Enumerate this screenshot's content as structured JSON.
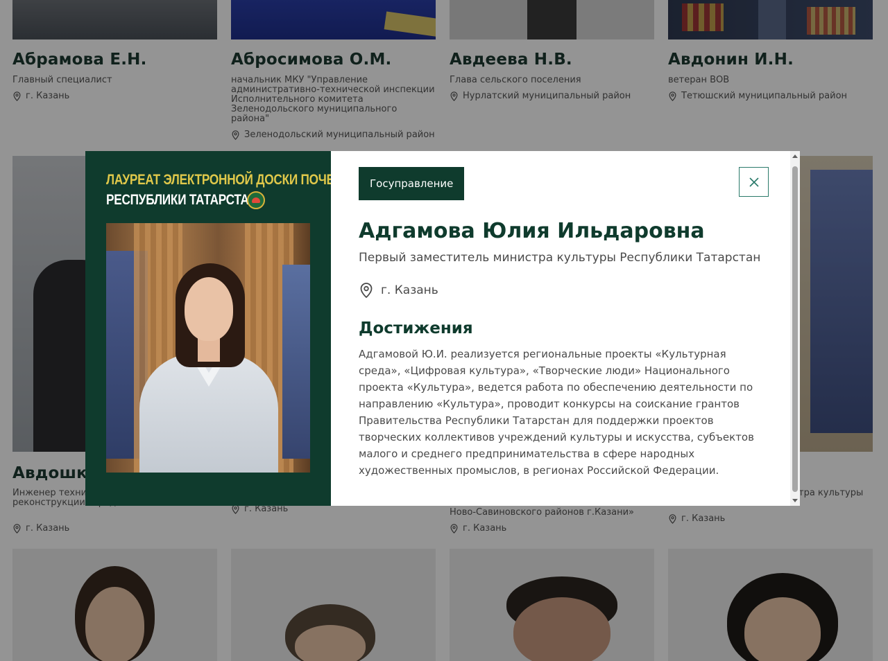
{
  "grid": {
    "row1": [
      {
        "name": "Абрамова Е.Н.",
        "position": "Главный специалист",
        "location": "г. Казань"
      },
      {
        "name": "Абросимова О.М.",
        "position": "начальник МКУ \"Управление административно-технической инспекции Исполнительного комитета Зеленодольского муниципального района\"",
        "location": "Зеленодольский муниципальный район"
      },
      {
        "name": "Авдеева Н.В.",
        "position": "Глава сельского поселения",
        "location": "Нурлатский муниципальный район"
      },
      {
        "name": "Авдонин И.Н.",
        "position": "ветеран ВОВ",
        "location": "Тетюшский муниципальный район"
      }
    ],
    "row2": [
      {
        "name": "Авдошки",
        "position": "Инженер техни \"Управление ка и реконструкции города Казани\"",
        "location": "г. Казань"
      },
      {
        "name": "",
        "position": "",
        "location": "г. Казань"
      },
      {
        "name": "",
        "position": "Ново-Савиновского районов г.Казани»",
        "location": "г. Казань"
      },
      {
        "name": "",
        "position": "тра культуры",
        "location": "г. Казань"
      }
    ]
  },
  "modal": {
    "laureate_line1": "ЛАУРЕАТ ЭЛЕКТРОННОЙ ДОСКИ ПОЧЕТА",
    "laureate_line2": "РЕСПУБЛИКИ ТАТАРСТАН",
    "tag": "Госуправление",
    "name": "Адгамова Юлия Ильдаровна",
    "position": "Первый заместитель министра культуры Республики Татарстан",
    "location": "г. Казань",
    "achievements_title": "Достижения",
    "achievements_text": "Адгамовой Ю.И. реализуется региональные проекты «Культурная среда», «Цифровая культура», «Творческие люди» Национального проекта «Культура», ведется работа по обеспечению деятельности по направлению «Культура», проводит конкурсы на соискание грантов Правительства Республики Татарстан для поддержки проектов творческих коллективов учреждений культуры и искусства, субъектов малого и среднего предпринимательства в сфере народных художественных промыслов, в регионах Российской Федерации."
  },
  "icons": {
    "close": "close-icon",
    "location": "location-pin-icon",
    "emblem": "tatarstan-emblem-icon"
  },
  "colors": {
    "brand_green": "#0f3b2d",
    "laureate_gold": "#e0c84a",
    "close_border": "#2a7a6a"
  }
}
